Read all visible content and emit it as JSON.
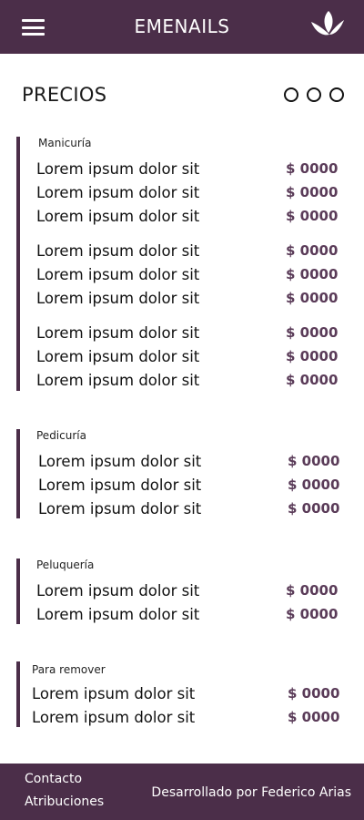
{
  "header": {
    "brand": "EMENAILS",
    "menu_icon": "hamburger-menu-icon",
    "logo_icon": "leaf-logo-icon",
    "background": "#4b2e49"
  },
  "page": {
    "title": "PRECIOS",
    "pager_dots": [
      "o",
      "o",
      "o"
    ]
  },
  "sections": [
    {
      "title": "Manicuría",
      "groups": [
        [
          {
            "name": "Lorem ipsum dolor sit",
            "price": "$ 0000"
          },
          {
            "name": "Lorem ipsum dolor sit",
            "price": "$ 0000"
          },
          {
            "name": "Lorem ipsum dolor sit",
            "price": "$ 0000"
          }
        ],
        [
          {
            "name": "Lorem ipsum dolor sit",
            "price": "$ 0000"
          },
          {
            "name": "Lorem ipsum dolor sit",
            "price": "$ 0000"
          },
          {
            "name": "Lorem ipsum dolor sit",
            "price": "$ 0000"
          }
        ],
        [
          {
            "name": "Lorem ipsum dolor sit",
            "price": "$ 0000"
          },
          {
            "name": "Lorem ipsum dolor sit",
            "price": "$ 0000"
          },
          {
            "name": "Lorem ipsum dolor sit",
            "price": "$ 0000"
          }
        ]
      ]
    },
    {
      "title": "Pedicuría",
      "groups": [
        [
          {
            "name": "Lorem ipsum dolor sit",
            "price": "$ 0000"
          },
          {
            "name": "Lorem ipsum dolor sit",
            "price": "$ 0000"
          },
          {
            "name": "Lorem ipsum dolor sit",
            "price": "$ 0000"
          }
        ]
      ]
    },
    {
      "title": "Peluquería",
      "groups": [
        [
          {
            "name": "Lorem ipsum dolor sit",
            "price": "$ 0000"
          },
          {
            "name": "Lorem ipsum dolor sit",
            "price": "$ 0000"
          }
        ]
      ]
    },
    {
      "title": "Para remover",
      "groups": [
        [
          {
            "name": "Lorem ipsum dolor sit",
            "price": "$ 0000"
          },
          {
            "name": "Lorem ipsum dolor sit",
            "price": "$ 0000"
          }
        ]
      ]
    }
  ],
  "footer": {
    "contact": "Contacto",
    "attributions": "Atribuciones",
    "credits": "Desarrollado por Federico Arias"
  },
  "colors": {
    "accent": "#4b2e49",
    "price": "#5a3b58"
  }
}
